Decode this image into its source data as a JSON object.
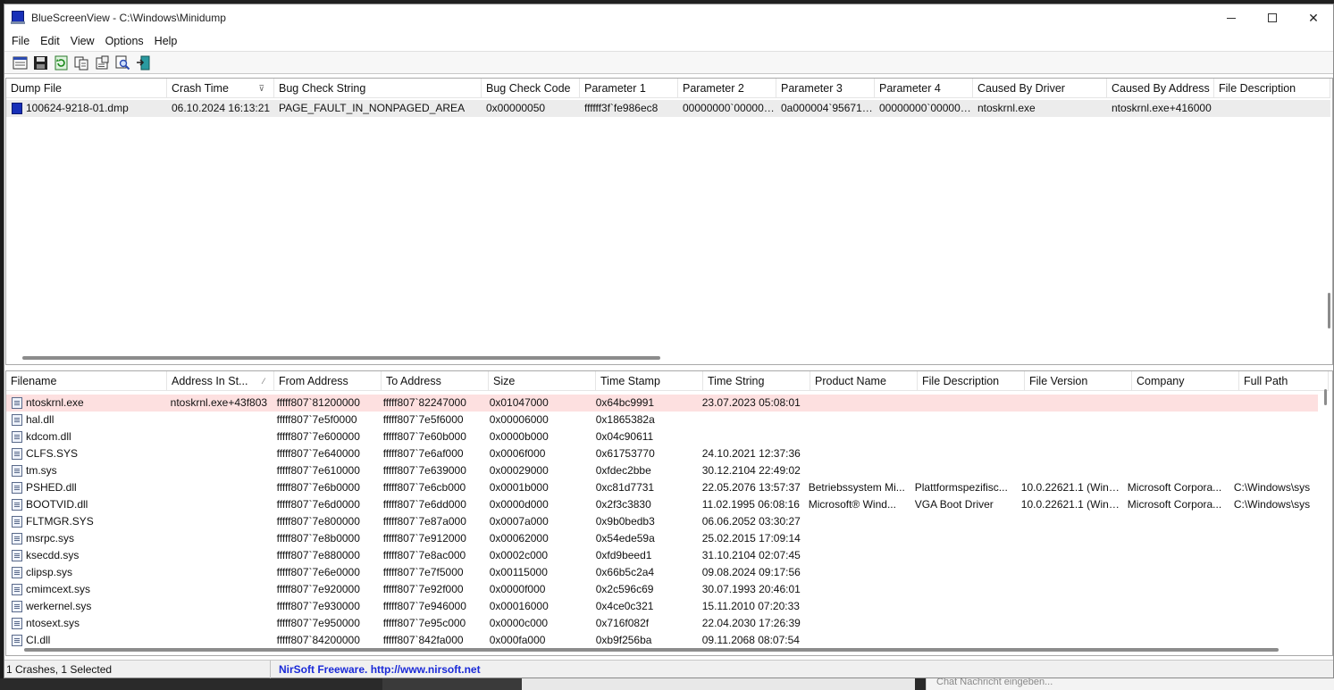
{
  "window": {
    "title": "BlueScreenView  -  C:\\Windows\\Minidump",
    "minimize": "–",
    "close": "✕"
  },
  "menu": [
    "File",
    "Edit",
    "View",
    "Options",
    "Help"
  ],
  "toolbar": [
    "properties-icon",
    "save-icon",
    "refresh-icon",
    "copy-icon",
    "html-report-icon",
    "find-icon",
    "exit-icon"
  ],
  "crashes": {
    "columns": [
      "Dump File",
      "Crash Time",
      "Bug Check String",
      "Bug Check Code",
      "Parameter 1",
      "Parameter 2",
      "Parameter 3",
      "Parameter 4",
      "Caused By Driver",
      "Caused By Address",
      "File Description"
    ],
    "sort_indicator": "⊽",
    "rows": [
      [
        "100624-9218-01.dmp",
        "06.10.2024 16:13:21",
        "PAGE_FAULT_IN_NONPAGED_AREA",
        "0x00000050",
        "ffffff3f`fe986ec8",
        "00000000`000000...",
        "0a000004`956718...",
        "00000000`000000...",
        "ntoskrnl.exe",
        "ntoskrnl.exe+416000",
        ""
      ]
    ]
  },
  "drivers": {
    "columns": [
      "Filename",
      "Address In St...",
      "From Address",
      "To Address",
      "Size",
      "Time Stamp",
      "Time String",
      "Product Name",
      "File Description",
      "File Version",
      "Company",
      "Full Path"
    ],
    "sort_indicator": "⁄",
    "rows": [
      [
        "ntoskrnl.exe",
        "ntoskrnl.exe+43f803",
        "fffff807`81200000",
        "fffff807`82247000",
        "0x01047000",
        "0x64bc9991",
        "23.07.2023 05:08:01",
        "",
        "",
        "",
        "",
        ""
      ],
      [
        "hal.dll",
        "",
        "fffff807`7e5f0000",
        "fffff807`7e5f6000",
        "0x00006000",
        "0x1865382a",
        "",
        "",
        "",
        "",
        "",
        ""
      ],
      [
        "kdcom.dll",
        "",
        "fffff807`7e600000",
        "fffff807`7e60b000",
        "0x0000b000",
        "0x04c90611",
        "",
        "",
        "",
        "",
        "",
        ""
      ],
      [
        "CLFS.SYS",
        "",
        "fffff807`7e640000",
        "fffff807`7e6af000",
        "0x0006f000",
        "0x61753770",
        "24.10.2021 12:37:36",
        "",
        "",
        "",
        "",
        ""
      ],
      [
        "tm.sys",
        "",
        "fffff807`7e610000",
        "fffff807`7e639000",
        "0x00029000",
        "0xfdec2bbe",
        "30.12.2104 22:49:02",
        "",
        "",
        "",
        "",
        ""
      ],
      [
        "PSHED.dll",
        "",
        "fffff807`7e6b0000",
        "fffff807`7e6cb000",
        "0x0001b000",
        "0xc81d7731",
        "22.05.2076 13:57:37",
        "Betriebssystem Mi...",
        "Plattformspezifisc...",
        "10.0.22621.1 (WinB...",
        "Microsoft Corpora...",
        "C:\\Windows\\sys"
      ],
      [
        "BOOTVID.dll",
        "",
        "fffff807`7e6d0000",
        "fffff807`7e6dd000",
        "0x0000d000",
        "0x2f3c3830",
        "11.02.1995 06:08:16",
        "Microsoft® Wind...",
        "VGA Boot Driver",
        "10.0.22621.1 (WinB...",
        "Microsoft Corpora...",
        "C:\\Windows\\sys"
      ],
      [
        "FLTMGR.SYS",
        "",
        "fffff807`7e800000",
        "fffff807`7e87a000",
        "0x0007a000",
        "0x9b0bedb3",
        "06.06.2052 03:30:27",
        "",
        "",
        "",
        "",
        ""
      ],
      [
        "msrpc.sys",
        "",
        "fffff807`7e8b0000",
        "fffff807`7e912000",
        "0x00062000",
        "0x54ede59a",
        "25.02.2015 17:09:14",
        "",
        "",
        "",
        "",
        ""
      ],
      [
        "ksecdd.sys",
        "",
        "fffff807`7e880000",
        "fffff807`7e8ac000",
        "0x0002c000",
        "0xfd9beed1",
        "31.10.2104 02:07:45",
        "",
        "",
        "",
        "",
        ""
      ],
      [
        "clipsp.sys",
        "",
        "fffff807`7e6e0000",
        "fffff807`7e7f5000",
        "0x00115000",
        "0x66b5c2a4",
        "09.08.2024 09:17:56",
        "",
        "",
        "",
        "",
        ""
      ],
      [
        "cmimcext.sys",
        "",
        "fffff807`7e920000",
        "fffff807`7e92f000",
        "0x0000f000",
        "0x2c596c69",
        "30.07.1993 20:46:01",
        "",
        "",
        "",
        "",
        ""
      ],
      [
        "werkernel.sys",
        "",
        "fffff807`7e930000",
        "fffff807`7e946000",
        "0x00016000",
        "0x4ce0c321",
        "15.11.2010 07:20:33",
        "",
        "",
        "",
        "",
        ""
      ],
      [
        "ntosext.sys",
        "",
        "fffff807`7e950000",
        "fffff807`7e95c000",
        "0x0000c000",
        "0x716f082f",
        "22.04.2030 17:26:39",
        "",
        "",
        "",
        "",
        ""
      ],
      [
        "CI.dll",
        "",
        "fffff807`84200000",
        "fffff807`842fa000",
        "0x000fa000",
        "0xb9f256ba",
        "09.11.2068 08:07:54",
        "",
        "",
        "",
        "",
        ""
      ]
    ]
  },
  "status": {
    "left": "1 Crashes, 1 Selected",
    "right": "NirSoft Freeware.  http://www.nirsoft.net"
  },
  "background": {
    "chat_placeholder": "Chat Nachricht eingeben..."
  }
}
